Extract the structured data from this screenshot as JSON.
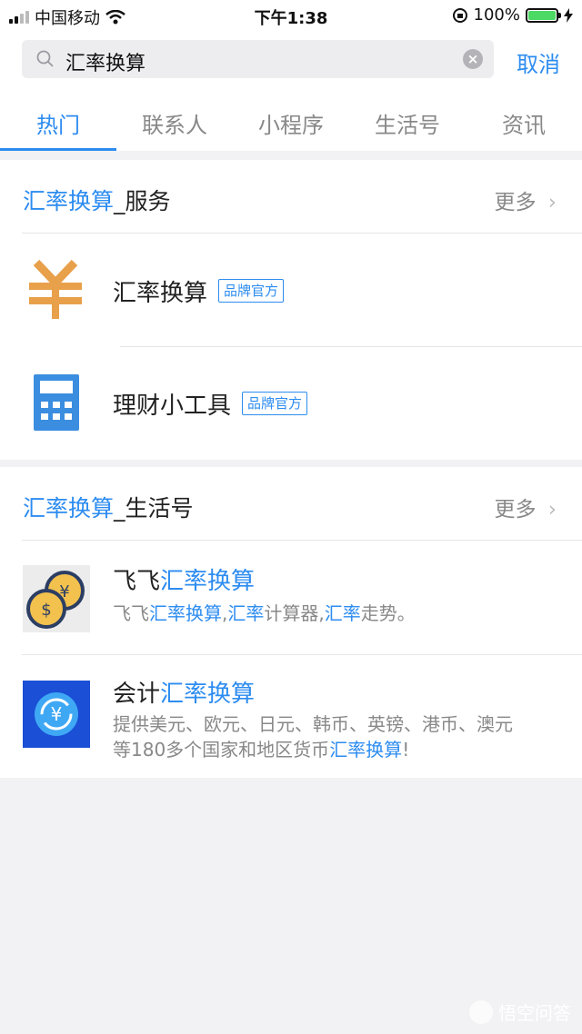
{
  "status_bar": {
    "carrier": "中国移动",
    "time": "下午1:38",
    "battery_text": "100%"
  },
  "search": {
    "query": "汇率换算",
    "cancel_label": "取消"
  },
  "tabs": [
    {
      "label": "热门",
      "active": true
    },
    {
      "label": "联系人",
      "active": false
    },
    {
      "label": "小程序",
      "active": false
    },
    {
      "label": "生活号",
      "active": false
    },
    {
      "label": "资讯",
      "active": false
    }
  ],
  "services": {
    "title_hl": "汇率换算",
    "title_rest": "_服务",
    "more_label": "更多",
    "items": [
      {
        "title": "汇率换算",
        "badge": "品牌官方",
        "icon": "yen-symbol-icon"
      },
      {
        "title": "理财小工具",
        "badge": "品牌官方",
        "icon": "calculator-icon"
      }
    ]
  },
  "life_accounts": {
    "title_hl": "汇率换算",
    "title_rest": "_生活号",
    "more_label": "更多",
    "items": [
      {
        "title_plain": "飞飞",
        "title_hl": "汇率换算",
        "desc": [
          {
            "text": "飞飞",
            "hl": false
          },
          {
            "text": "汇率换算",
            "hl": true
          },
          {
            "text": ",",
            "hl": false
          },
          {
            "text": "汇率",
            "hl": true
          },
          {
            "text": "计算器,",
            "hl": false
          },
          {
            "text": "汇率",
            "hl": true
          },
          {
            "text": "走势。",
            "hl": false
          }
        ],
        "icon": "coins-icon"
      },
      {
        "title_plain": "会计",
        "title_hl": "汇率换算",
        "desc_line1": "提供美元、欧元、日元、韩币、英镑、港币、澳元",
        "desc_line2_plain": "等180多个国家和地区货币",
        "desc_line2_hl": "汇率换算",
        "desc_line2_end": "!",
        "icon": "yen-exchange-icon"
      }
    ]
  },
  "watermark": {
    "text": "悟空问答"
  },
  "colors": {
    "accent": "#2d8cf0",
    "calc_blue": "#3b8de0",
    "yen_orange": "#e8a04a"
  }
}
